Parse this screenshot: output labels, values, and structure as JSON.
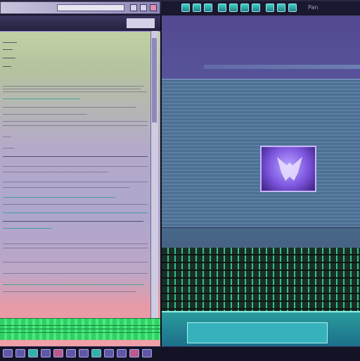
{
  "left_window": {
    "title": "",
    "url": ""
  },
  "right_toolbar": {
    "icons": [
      "tool-icon",
      "tool-icon",
      "tool-icon",
      "tool-icon",
      "tool-icon",
      "tool-icon",
      "tool-icon",
      "tool-icon",
      "tool-icon",
      "tool-icon",
      "tool-icon",
      "tool-icon",
      "tool-icon",
      "tool-icon",
      "tool-icon"
    ],
    "label": "Pan"
  },
  "taskbar": {
    "apps": [
      "app-icon",
      "app-icon",
      "app-icon",
      "app-icon",
      "app-icon",
      "app-icon",
      "app-icon",
      "app-icon",
      "app-icon",
      "app-icon",
      "app-icon",
      "app-icon"
    ]
  },
  "colors": {
    "accent": "#2fcf6a",
    "preview_purple": "#7d56df",
    "teal": "#37b2bd"
  }
}
